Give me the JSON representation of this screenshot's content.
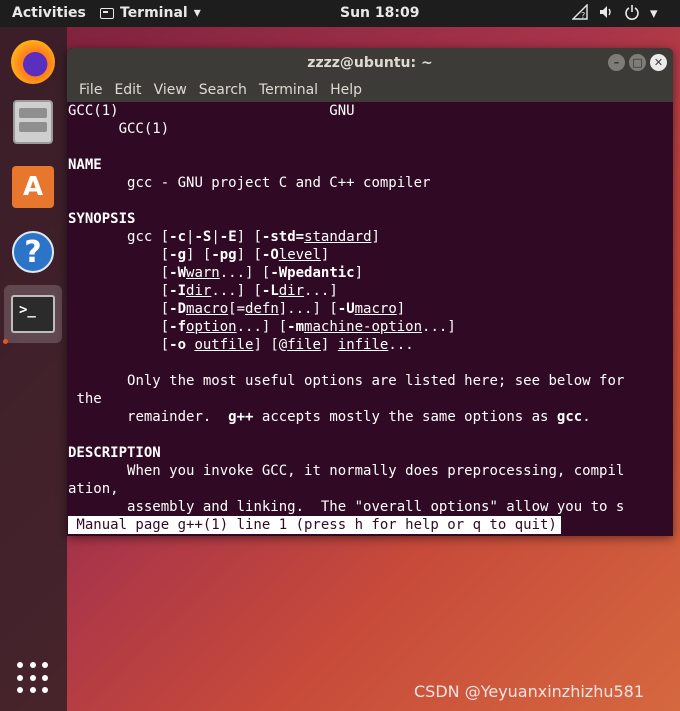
{
  "topbar": {
    "activities": "Activities",
    "app_menu": "Terminal",
    "app_menu_arrow": "▾",
    "clock": "Sun 18:09",
    "tray": {
      "network_icon": "network-question",
      "volume_icon": "volume",
      "power_icon": "power",
      "menu_arrow": "▾"
    }
  },
  "dock": {
    "items": [
      {
        "name": "Firefox",
        "icon": "firefox-icon"
      },
      {
        "name": "Files",
        "icon": "files-icon"
      },
      {
        "name": "Ubuntu Software",
        "icon": "software-center-icon",
        "glyph": "A"
      },
      {
        "name": "Help",
        "icon": "help-icon",
        "glyph": "?"
      },
      {
        "name": "Terminal",
        "icon": "terminal-icon",
        "active": true
      }
    ],
    "show_apps_icon": "show-applications-icon"
  },
  "window": {
    "title": "zzzz@ubuntu: ~",
    "buttons": {
      "minimize": "–",
      "maximize": "□",
      "close": "✕"
    },
    "menu": [
      "File",
      "Edit",
      "View",
      "Search",
      "Terminal",
      "Help"
    ]
  },
  "manpage": {
    "header_left": "GCC(1)",
    "header_center": "GNU",
    "header_right": "GCC(1)",
    "name_heading": "NAME",
    "name_text": "gcc - GNU project C and C++ compiler",
    "synopsis_heading": "SYNOPSIS",
    "synopsis": {
      "s1": "gcc [",
      "s2": "-c",
      "s3": "|",
      "s4": "-S",
      "s5": "|",
      "s6": "-E",
      "s7": "] [",
      "s8": "-std=",
      "s9": "standard",
      "s10": "]",
      "r2a": "[",
      "r2b": "-g",
      "r2c": "] [",
      "r2d": "-pg",
      "r2e": "] [",
      "r2f": "-O",
      "r2g": "level",
      "r2h": "]",
      "r3a": "[",
      "r3b": "-W",
      "r3c": "warn",
      "r3d": "...] [",
      "r3e": "-Wpedantic",
      "r3f": "]",
      "r4a": "[",
      "r4b": "-I",
      "r4c": "dir",
      "r4d": "...] [",
      "r4e": "-L",
      "r4f": "dir",
      "r4g": "...]",
      "r5a": "[",
      "r5b": "-D",
      "r5c": "macro",
      "r5d": "[=",
      "r5e": "defn",
      "r5f": "]...] [",
      "r5g": "-U",
      "r5h": "macro",
      "r5i": "]",
      "r6a": "[",
      "r6b": "-f",
      "r6c": "option",
      "r6d": "...] [",
      "r6e": "-m",
      "r6f": "machine-option",
      "r6g": "...]",
      "r7a": "[",
      "r7b": "-o",
      "r7c": " ",
      "r7d": "outfile",
      "r7e": "] [@",
      "r7f": "file",
      "r7g": "] ",
      "r7h": "infile",
      "r7i": "..."
    },
    "only_line1": "Only the most useful options are listed here; see below for",
    "only_line2": "the",
    "only_line3a": "remainder.  ",
    "only_line3b": "g++",
    "only_line3c": " accepts mostly the same options as ",
    "only_line3d": "gcc",
    "only_line3e": ".",
    "description_heading": "DESCRIPTION",
    "desc_line1": "When you invoke GCC, it normally does preprocessing, compil",
    "desc_line2": "ation,",
    "desc_line3": "assembly and linking.  The \"overall options\" allow you to s",
    "status": " Manual page g++(1) line 1 (press h for help or q to quit)"
  },
  "watermark": "CSDN @Yeyuanxinzhizhu581"
}
